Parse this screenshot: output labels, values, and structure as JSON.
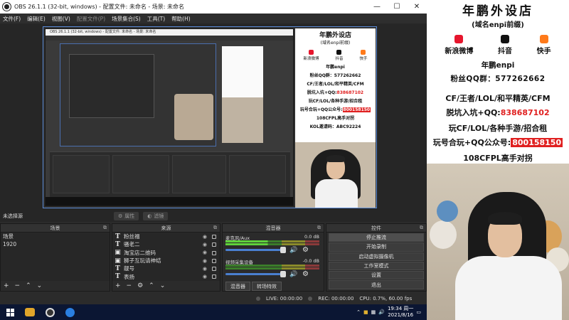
{
  "obs": {
    "title": "OBS 26.1.1 (32-bit, windows) - 配置文件: 未命名 - 场景: 未命名",
    "menu": [
      "文件(F)",
      "编辑(E)",
      "视图(V)",
      "配置文件(P)",
      "场景集合(S)",
      "工具(T)",
      "帮助(H)"
    ],
    "no_source_selected": "未选择源",
    "properties_label": "属性",
    "filters_label": "滤镜",
    "scenes": {
      "title": "场景",
      "items": [
        "场景",
        "1920"
      ]
    },
    "sources": {
      "title": "来源",
      "items": [
        "粉丝福",
        "骚老二",
        "淘宝店二维码",
        "狮子互玩请神结",
        "靓号",
        "表扬"
      ]
    },
    "mixer": {
      "title": "混音器",
      "channels": [
        {
          "name": "麦克风/Aux",
          "db": "0.0 dB"
        },
        {
          "name": "视频采集设备",
          "db": "-0.0 dB"
        }
      ],
      "tabs": [
        "混音器",
        "转场特效"
      ]
    },
    "controls": {
      "title": "控件",
      "buttons": [
        "停止推流",
        "开始录制",
        "启动虚拟摄像机",
        "工作室模式",
        "设置",
        "退出"
      ]
    },
    "status": {
      "live": "LIVE: 00:00:00",
      "rec": "REC: 00:00:00",
      "cpu": "CPU: 0.7%, 60.00 fps"
    },
    "inner_title": "OBS 26.1.1 (32-bit, windows) - 配置文件: 未命名 - 场景: 未命名"
  },
  "taskbar": {
    "time": "19:34 周一",
    "date": "2021/8/16"
  },
  "ad": {
    "title": "年鹏外设店",
    "subtitle": "(域名enpi前缀)",
    "socials": [
      {
        "label": "新浪微博",
        "icon": "weibo-icon",
        "color": "#e6162d"
      },
      {
        "label": "抖音",
        "icon": "douyin-icon",
        "color": "#111111"
      },
      {
        "label": "快手",
        "icon": "kuaishou-icon",
        "color": "#ff7a1a"
      }
    ],
    "id_line": "年鹏enpi",
    "qq_line": "粉丝QQ群：577262662",
    "line1": "CF/王者/LOL/和平精英/CFM",
    "line2_prefix": "脱坑入坑+QQ:",
    "line2_value": "838687102",
    "line3": "玩CF/LOL/各种手游/招合租",
    "line4_prefix": "玩号合玩+QQ公众号:",
    "line4_value": "800158150",
    "line5": "108CFPL高手对拐",
    "line6": "KOL邀请码：ABC92224"
  },
  "colors": {
    "accent_blue": "#4a7fd0",
    "ad_red": "#e02020",
    "taskbar_bg": "#0b1633"
  }
}
